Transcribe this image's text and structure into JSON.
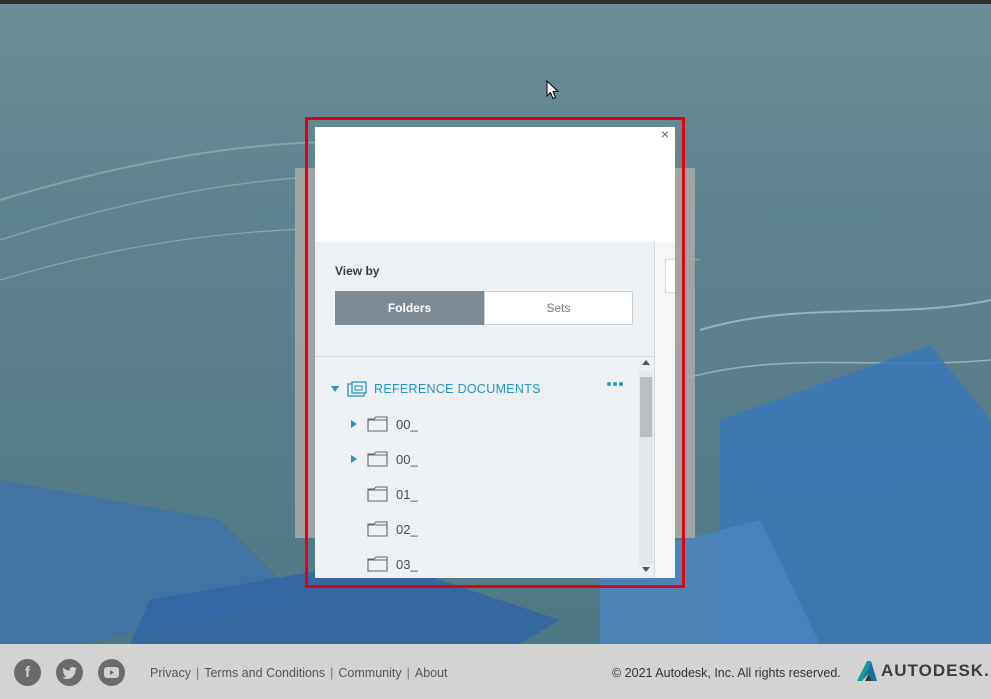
{
  "dialog": {
    "close_glyph": "×",
    "view_by_label": "View by",
    "segments": {
      "folders": "Folders",
      "sets": "Sets"
    },
    "tree": {
      "root_label": "REFERENCE DOCUMENTS",
      "items": [
        {
          "label": "00_",
          "expandable": true
        },
        {
          "label": "00_",
          "expandable": true
        },
        {
          "label": "01_",
          "expandable": false
        },
        {
          "label": "02_",
          "expandable": false
        },
        {
          "label": "03_",
          "expandable": false
        }
      ]
    }
  },
  "footer": {
    "social": [
      "facebook-icon",
      "twitter-icon",
      "youtube-icon"
    ],
    "links": [
      "Privacy",
      "Terms and Conditions",
      "Community",
      "About"
    ],
    "copyright": "© 2021 Autodesk, Inc. All rights reserved.",
    "logo_text": "AUTODESK."
  },
  "colors": {
    "accent": "#2393c9",
    "highlight_border": "#e3000f",
    "segment_active": "#7c8a96"
  }
}
